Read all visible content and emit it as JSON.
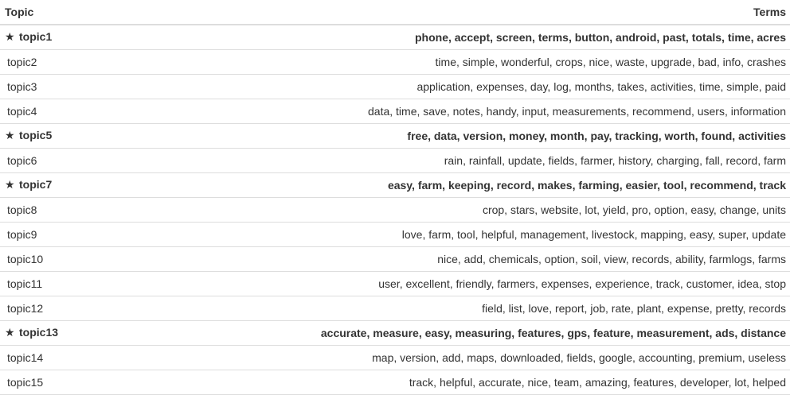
{
  "table": {
    "headers": {
      "topic": "Topic",
      "terms": "Terms"
    },
    "star_glyph": "★",
    "rows": [
      {
        "topic": "topic1",
        "starred": true,
        "terms": "phone, accept, screen, terms, button, android, past, totals, time, acres"
      },
      {
        "topic": "topic2",
        "starred": false,
        "terms": "time, simple, wonderful, crops, nice, waste, upgrade, bad, info, crashes"
      },
      {
        "topic": "topic3",
        "starred": false,
        "terms": "application, expenses, day, log, months, takes, activities, time, simple, paid"
      },
      {
        "topic": "topic4",
        "starred": false,
        "terms": "data, time, save, notes, handy, input, measurements, recommend, users, information"
      },
      {
        "topic": "topic5",
        "starred": true,
        "terms": "free, data, version, money, month, pay, tracking, worth, found, activities"
      },
      {
        "topic": "topic6",
        "starred": false,
        "terms": "rain, rainfall, update, fields, farmer, history, charging, fall, record, farm"
      },
      {
        "topic": "topic7",
        "starred": true,
        "terms": "easy, farm, keeping, record, makes, farming, easier, tool, recommend, track"
      },
      {
        "topic": "topic8",
        "starred": false,
        "terms": "crop, stars, website, lot, yield, pro, option, easy, change, units"
      },
      {
        "topic": "topic9",
        "starred": false,
        "terms": "love, farm, tool, helpful, management, livestock, mapping, easy, super, update"
      },
      {
        "topic": "topic10",
        "starred": false,
        "terms": "nice, add, chemicals, option, soil, view, records, ability, farmlogs, farms"
      },
      {
        "topic": "topic11",
        "starred": false,
        "terms": "user, excellent, friendly, farmers, expenses, experience, track, customer, idea, stop"
      },
      {
        "topic": "topic12",
        "starred": false,
        "terms": "field, list, love, report, job, rate, plant, expense, pretty, records"
      },
      {
        "topic": "topic13",
        "starred": true,
        "terms": "accurate, measure, easy, measuring, features, gps, feature, measurement, ads, distance"
      },
      {
        "topic": "topic14",
        "starred": false,
        "terms": "map, version, add, maps, downloaded, fields, google, accounting, premium, useless"
      },
      {
        "topic": "topic15",
        "starred": false,
        "terms": "track, helpful, accurate, nice, team, amazing, features, developer, lot, helped"
      }
    ]
  }
}
